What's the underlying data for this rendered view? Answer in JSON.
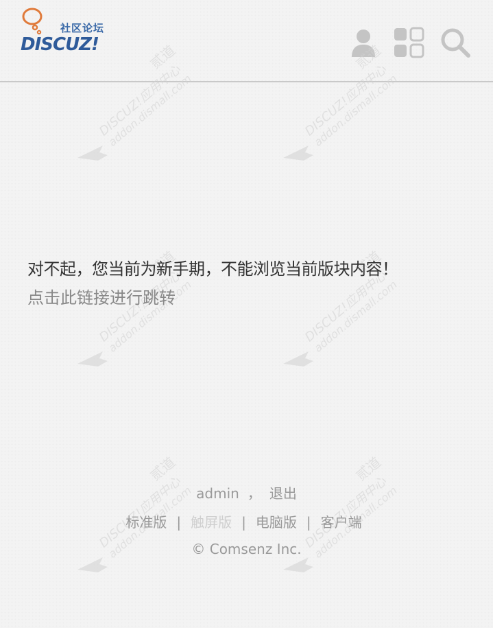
{
  "header": {
    "logo_cn": "社区论坛",
    "logo_en": "DISCUZ!",
    "icons": [
      "user-icon",
      "apps-icon",
      "search-icon"
    ]
  },
  "message": {
    "text": "对不起，您当前为新手期，不能浏览当前版块内容！",
    "link": "点击此链接进行跳转"
  },
  "footer": {
    "username": "admin",
    "comma": "，",
    "logout": "退出",
    "nav": [
      "标准版",
      "触屏版",
      "电脑版",
      "客户端"
    ],
    "separator": "|",
    "copyright": "© Comsenz Inc."
  },
  "watermark": {
    "line1": "DISCUZ!应用中心",
    "line2": "addon.dismall.com",
    "line3": "贰道"
  },
  "colors": {
    "background": "#f3f3f3",
    "logo_blue": "#2f5b9a",
    "logo_orange": "#e07a3a",
    "icon_gray": "#c4c4c4",
    "text_dark": "#333333",
    "text_muted": "#999999"
  }
}
